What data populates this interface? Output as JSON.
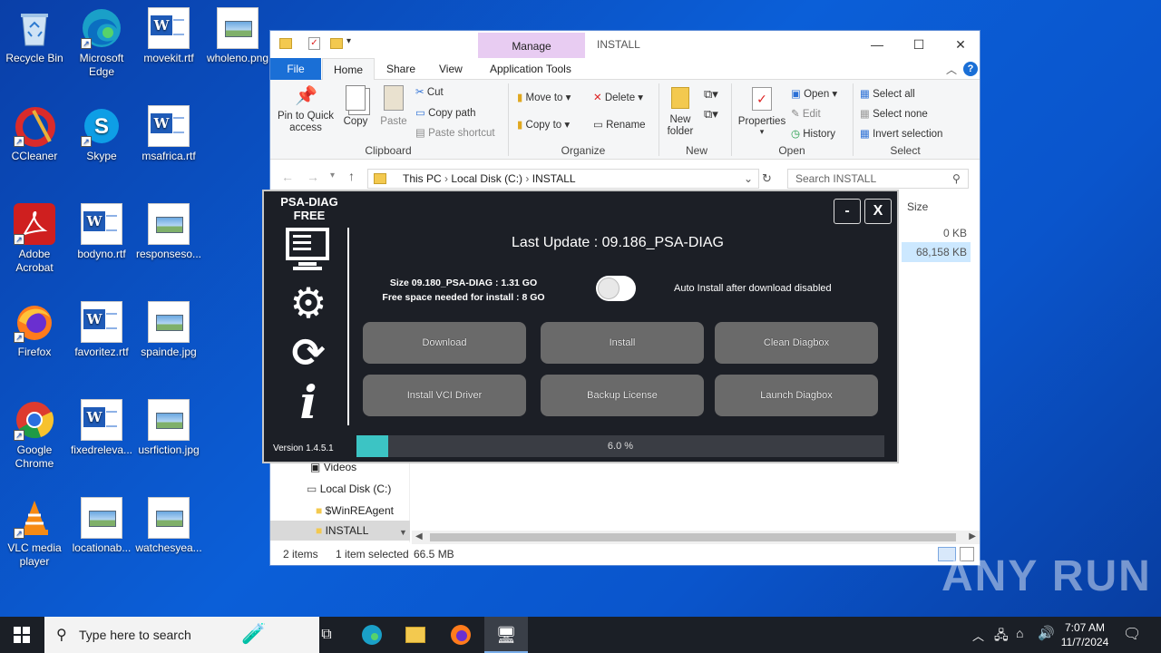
{
  "desktop": {
    "icons": [
      {
        "label": "Recycle Bin",
        "type": "bin"
      },
      {
        "label": "Microsoft Edge",
        "type": "edge"
      },
      {
        "label": "movekit.rtf",
        "type": "doc"
      },
      {
        "label": "wholeno.png",
        "type": "img"
      },
      {
        "label": "CCleaner",
        "type": "ccleaner"
      },
      {
        "label": "Skype",
        "type": "skype"
      },
      {
        "label": "msafrica.rtf",
        "type": "doc"
      },
      {
        "label": "Adobe Acrobat",
        "type": "acrobat"
      },
      {
        "label": "bodyno.rtf",
        "type": "doc"
      },
      {
        "label": "responseso...",
        "type": "img"
      },
      {
        "label": "Firefox",
        "type": "firefox"
      },
      {
        "label": "favoritez.rtf",
        "type": "doc"
      },
      {
        "label": "spainde.jpg",
        "type": "img"
      },
      {
        "label": "Google Chrome",
        "type": "chrome"
      },
      {
        "label": "fixedreleva...",
        "type": "doc"
      },
      {
        "label": "usrfiction.jpg",
        "type": "img"
      },
      {
        "label": "VLC media player",
        "type": "vlc"
      },
      {
        "label": "locationab...",
        "type": "img"
      },
      {
        "label": "watchesyea...",
        "type": "img"
      }
    ]
  },
  "explorer": {
    "manage_tab": "Manage",
    "title": "INSTALL",
    "tabs": {
      "file": "File",
      "home": "Home",
      "share": "Share",
      "view": "View",
      "app_tools": "Application Tools"
    },
    "clipboard": {
      "pin": "Pin to Quick access",
      "copy": "Copy",
      "paste": "Paste",
      "cut": "Cut",
      "copy_path": "Copy path",
      "paste_shortcut": "Paste shortcut",
      "label": "Clipboard"
    },
    "organize": {
      "move_to": "Move to",
      "copy_to": "Copy to",
      "delete": "Delete",
      "rename": "Rename",
      "label": "Organize"
    },
    "new": {
      "new_folder": "New folder",
      "label": "New"
    },
    "open": {
      "properties": "Properties",
      "open": "Open",
      "edit": "Edit",
      "history": "History",
      "label": "Open"
    },
    "select": {
      "select_all": "Select all",
      "select_none": "Select none",
      "invert": "Invert selection",
      "label": "Select"
    },
    "address": {
      "this_pc": "This PC",
      "disk": "Local Disk (C:)",
      "folder": "INSTALL"
    },
    "search_placeholder": "Search INSTALL",
    "column_size": "Size",
    "files": [
      {
        "size": "0 KB"
      },
      {
        "size": "68,158 KB"
      }
    ],
    "nav": {
      "videos": "Videos",
      "disk": "Local Disk (C:)",
      "winre": "$WinREAgent",
      "install": "INSTALL"
    },
    "status": {
      "items": "2 items",
      "selected": "1 item selected",
      "size": "66.5 MB"
    }
  },
  "psa": {
    "app_title_1": "PSA-DIAG",
    "app_title_2": "FREE",
    "minimize": "-",
    "close": "X",
    "last_update": "Last Update : 09.186_PSA-DIAG",
    "size_line": "Size 09.180_PSA-DIAG : 1.31 GO",
    "free_line": "Free space needed for install : 8 GO",
    "auto_install": "Auto Install after download disabled",
    "buttons": [
      "Download",
      "Install",
      "Clean Diagbox",
      "Install VCI Driver",
      "Backup License",
      "Launch Diagbox"
    ],
    "version": "Version 1.4.5.1",
    "progress_text": "6.0 %",
    "progress": 0.06
  },
  "taskbar": {
    "search_placeholder": "Type here to search",
    "time": "7:07 AM",
    "date": "11/7/2024"
  },
  "watermark": "ANY RUN"
}
